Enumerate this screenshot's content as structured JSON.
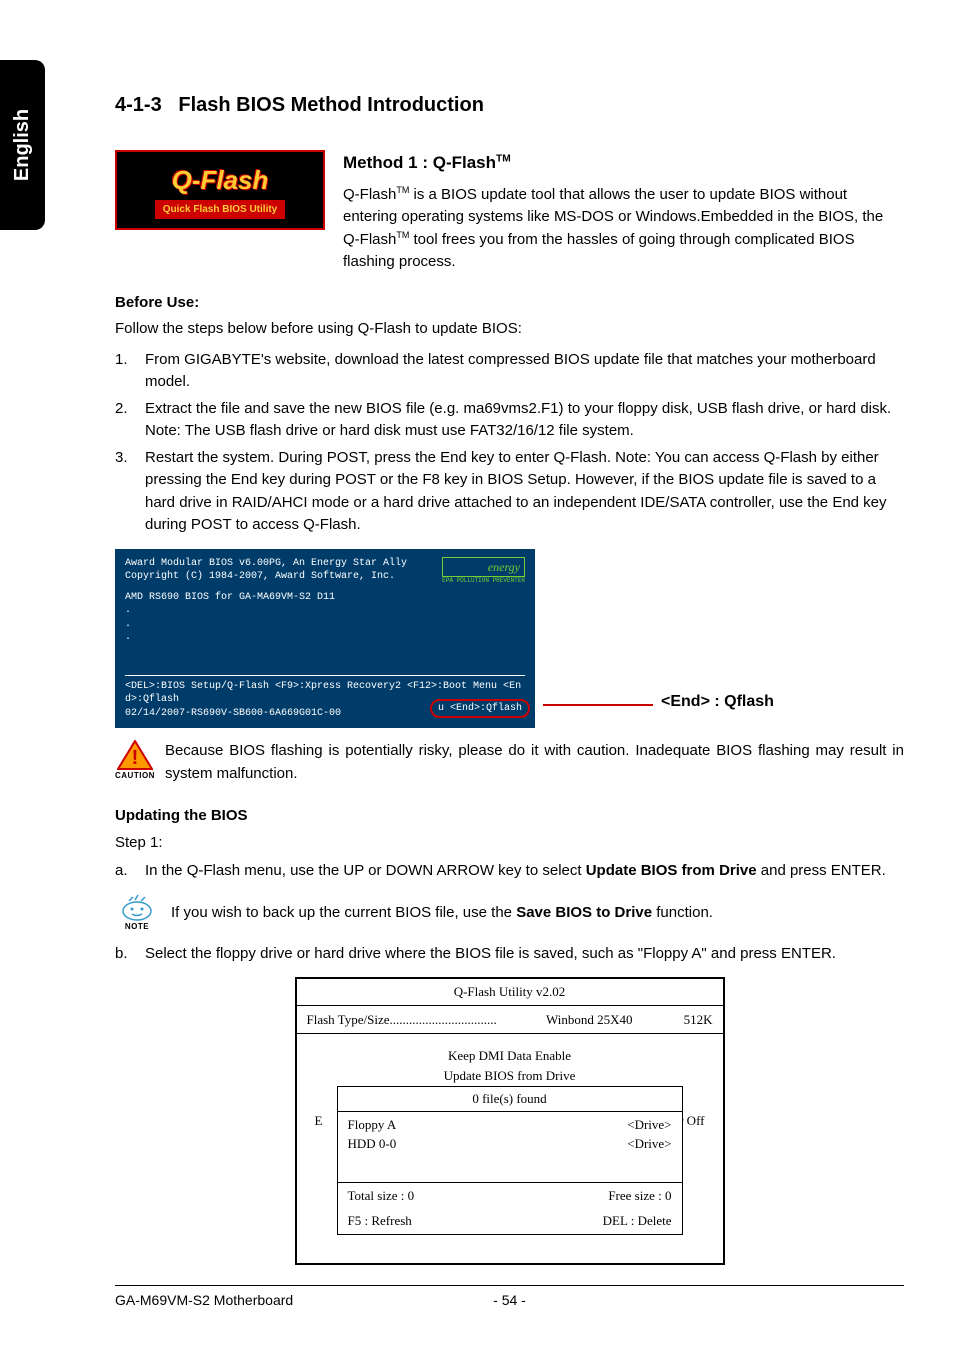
{
  "sideTab": "English",
  "sectionNumber": "4-1-3",
  "sectionTitle": "Flash BIOS Method Introduction",
  "logo": {
    "main": "Q-Flash",
    "sub": "Quick Flash BIOS Utility"
  },
  "method1": {
    "titlePrefix": "Method 1 : Q-Flash",
    "tm": "TM",
    "intro1": "Q-Flash",
    "intro2": " is a BIOS update tool that allows the user to update BIOS without entering operating systems like MS-DOS or Windows.Embedded in the BIOS, the Q-Flash",
    "intro3": " tool frees you from the hassles of going through complicated BIOS flashing process."
  },
  "beforeUse": {
    "label": "Before Use:",
    "intro": "Follow the steps below before using Q-Flash to update BIOS:",
    "items": [
      "From GIGABYTE's website, download the latest compressed BIOS update file that matches your motherboard model.",
      "Extract the file and save the new BIOS file (e.g. ma69vms2.F1) to your floppy disk, USB flash drive, or hard disk. Note: The USB flash drive or hard disk must use FAT32/16/12 file system.",
      "Restart the system. During POST, press the End key to enter Q-Flash.  Note: You can access Q-Flash by either pressing the End key during POST or the F8 key in BIOS Setup. However, if the BIOS update file is saved to a hard drive in RAID/AHCI mode or a hard drive attached to an independent IDE/SATA controller, use the End key during POST to access Q-Flash."
    ]
  },
  "biosScreen": {
    "line1": "Award Modular BIOS v6.00PG, An Energy Star Ally",
    "line2": "Copyright (C) 1984-2007, Award Software, Inc.",
    "energy": "energy",
    "epa": "EPA POLLUTION PREVENTER",
    "line3": "AMD RS690 BIOS for GA-MA69VM-S2 D11",
    "footer1": "<DEL>:BIOS Setup/Q-Flash <F9>:Xpress Recovery2 <F12>:Boot Menu <End>:Qflash",
    "footer2": "02/14/2007-RS690V-SB600-6A669G01C-00",
    "highlight": "u <End>:Qflash"
  },
  "callout": "<End> : Qflash",
  "caution": {
    "label": "CAUTION",
    "text": "Because BIOS flashing is potentially risky, please do it with caution. Inadequate BIOS flashing may result in system malfunction."
  },
  "updating": {
    "heading": "Updating the BIOS",
    "step1": "Step 1:",
    "a_prefix": "In the Q-Flash menu, use the UP or DOWN ARROW key to select ",
    "a_bold": "Update BIOS from Drive",
    "a_suffix": " and press ENTER.",
    "note_prefix": "If you wish to back up the current BIOS file, use the ",
    "note_bold": "Save BIOS to Drive",
    "note_suffix": " function.",
    "noteLabel": "NOTE",
    "b": "Select the floppy drive or hard drive where the BIOS file is saved, such as \"Floppy A\" and press ENTER."
  },
  "qflashUtil": {
    "title": "Q-Flash Utility v2.02",
    "flashLabel": "Flash Type/Size",
    "flashVal": "Winbond 25X40",
    "flashSize": "512K",
    "keepDmi": "Keep DMI Data    Enable",
    "updateFrom": "Update BIOS from Drive",
    "behindLeft": "E",
    "behindRight": "er Off",
    "frontTitle": "0 file(s) found",
    "rows": [
      {
        "name": "Floppy A",
        "type": "<Drive>"
      },
      {
        "name": "HDD 0-0",
        "type": "<Drive>"
      }
    ],
    "totalSize": "Total size : 0",
    "freeSize": "Free size : 0",
    "f5": "F5 : Refresh",
    "del": "DEL : Delete"
  },
  "footer": {
    "left": "GA-M69VM-S2 Motherboard",
    "center": "- 54 -"
  }
}
